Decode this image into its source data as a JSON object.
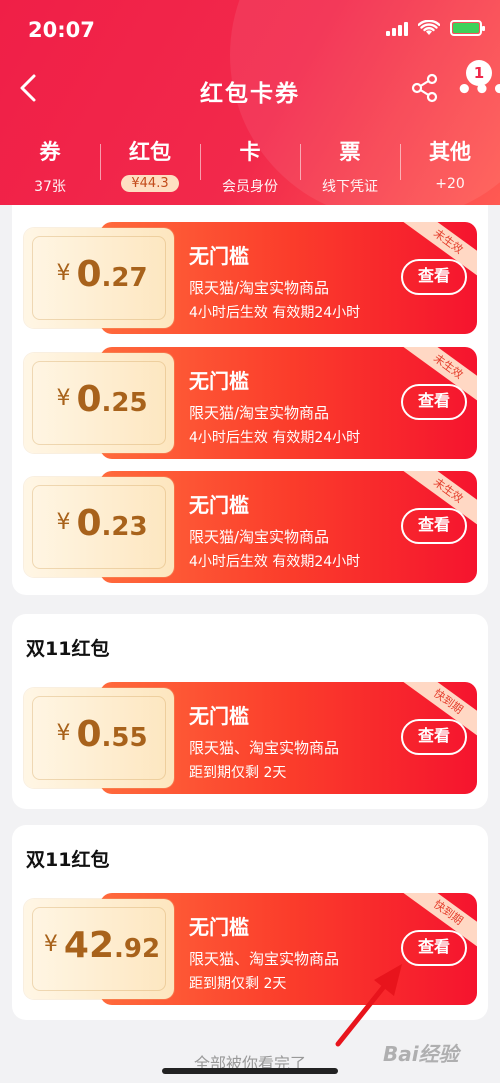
{
  "status": {
    "time": "20:07"
  },
  "nav": {
    "title": "红包卡券",
    "badge": "1"
  },
  "tabs": [
    {
      "label": "券",
      "sub": "37张"
    },
    {
      "label": "红包",
      "sub": "¥44.3"
    },
    {
      "label": "卡",
      "sub": "会员身份"
    },
    {
      "label": "票",
      "sub": "线下凭证"
    },
    {
      "label": "其他",
      "sub": "+20"
    }
  ],
  "groups": [
    {
      "title": "",
      "coupons": [
        {
          "amount_int": "0",
          "amount_dec": ".27",
          "yen": "¥",
          "name": "无门槛",
          "line1": "限天猫/淘宝实物商品",
          "line2": "4小时后生效 有效期24小时",
          "button": "查看",
          "ribbon": "未生效"
        },
        {
          "amount_int": "0",
          "amount_dec": ".25",
          "yen": "¥",
          "name": "无门槛",
          "line1": "限天猫/淘宝实物商品",
          "line2": "4小时后生效 有效期24小时",
          "button": "查看",
          "ribbon": "未生效"
        },
        {
          "amount_int": "0",
          "amount_dec": ".23",
          "yen": "¥",
          "name": "无门槛",
          "line1": "限天猫/淘宝实物商品",
          "line2": "4小时后生效 有效期24小时",
          "button": "查看",
          "ribbon": "未生效"
        }
      ]
    },
    {
      "title": "双11红包",
      "coupons": [
        {
          "amount_int": "0",
          "amount_dec": ".55",
          "yen": "¥",
          "name": "无门槛",
          "line1": "限天猫、淘宝实物商品",
          "line2": "距到期仅剩 2天",
          "button": "查看",
          "ribbon": "快到期"
        }
      ]
    },
    {
      "title": "双11红包",
      "coupons": [
        {
          "amount_int": "42",
          "amount_dec": ".92",
          "yen": "¥",
          "name": "无门槛",
          "line1": "限天猫、淘宝实物商品",
          "line2": "距到期仅剩 2天",
          "button": "查看",
          "ribbon": "快到期"
        }
      ]
    }
  ],
  "footer": {
    "text": "全部被你看完了"
  },
  "watermark": "Bai经验",
  "colors": {
    "header": "#f01f47",
    "coupon_red": "#f5142e",
    "coupon_gold": "#a8621b"
  }
}
